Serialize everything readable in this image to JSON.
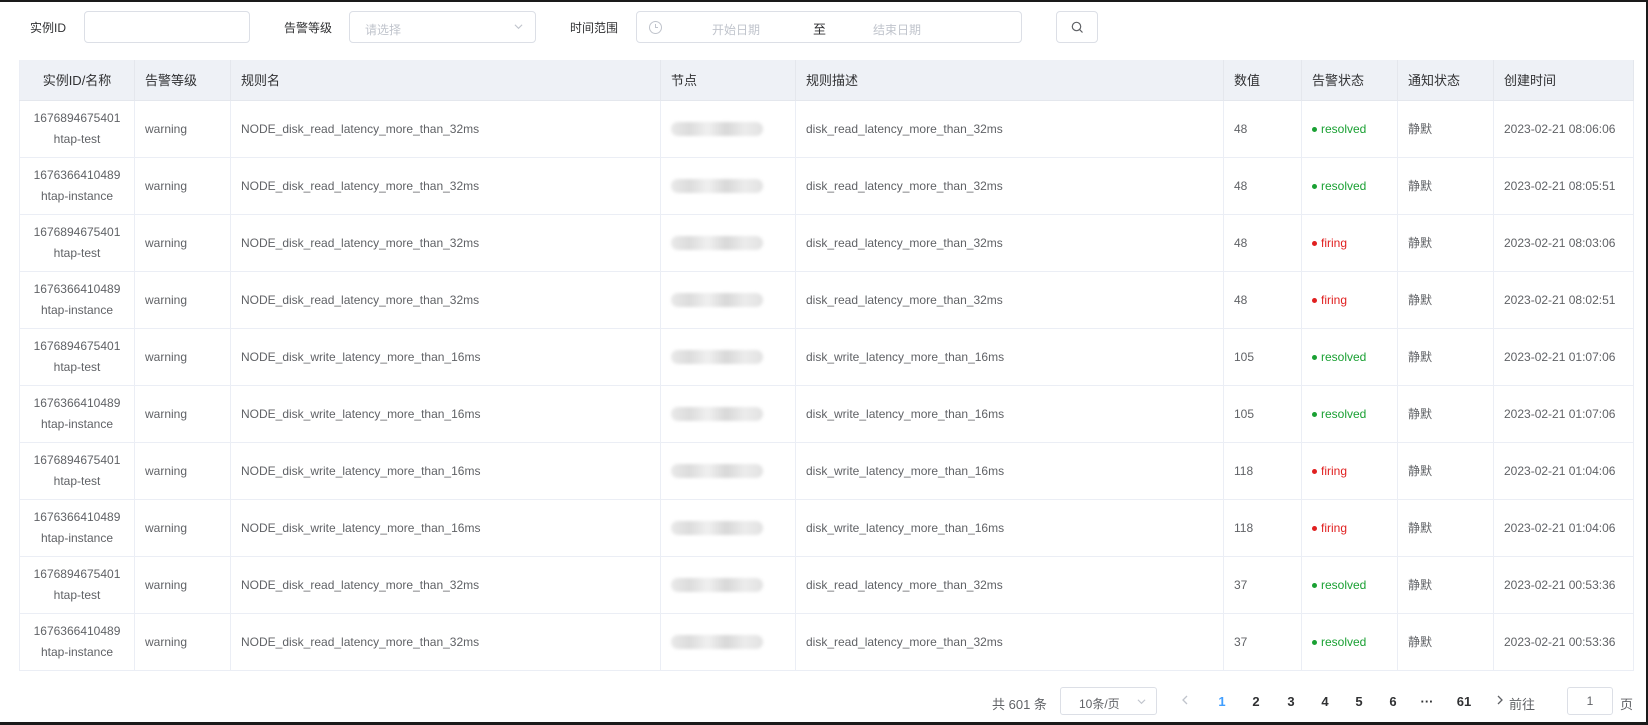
{
  "filters": {
    "instance_id_label": "实例ID",
    "instance_id_value": "",
    "alert_level_label": "告警等级",
    "alert_level_placeholder": "请选择",
    "time_range_label": "时间范围",
    "start_date_placeholder": "开始日期",
    "separator": "至",
    "end_date_placeholder": "结束日期"
  },
  "table": {
    "columns": [
      "实例ID/名称",
      "告警等级",
      "规则名",
      "节点",
      "规则描述",
      "数值",
      "告警状态",
      "通知状态",
      "创建时间"
    ],
    "rows": [
      {
        "id": "1676894675401",
        "name": "htap-test",
        "level": "warning",
        "rule": "NODE_disk_read_latency_more_than_32ms",
        "desc": "disk_read_latency_more_than_32ms",
        "value": "48",
        "status": "resolved",
        "notify": "静默",
        "created": "2023-02-21 08:06:06"
      },
      {
        "id": "1676366410489",
        "name": "htap-instance",
        "level": "warning",
        "rule": "NODE_disk_read_latency_more_than_32ms",
        "desc": "disk_read_latency_more_than_32ms",
        "value": "48",
        "status": "resolved",
        "notify": "静默",
        "created": "2023-02-21 08:05:51"
      },
      {
        "id": "1676894675401",
        "name": "htap-test",
        "level": "warning",
        "rule": "NODE_disk_read_latency_more_than_32ms",
        "desc": "disk_read_latency_more_than_32ms",
        "value": "48",
        "status": "firing",
        "notify": "静默",
        "created": "2023-02-21 08:03:06"
      },
      {
        "id": "1676366410489",
        "name": "htap-instance",
        "level": "warning",
        "rule": "NODE_disk_read_latency_more_than_32ms",
        "desc": "disk_read_latency_more_than_32ms",
        "value": "48",
        "status": "firing",
        "notify": "静默",
        "created": "2023-02-21 08:02:51"
      },
      {
        "id": "1676894675401",
        "name": "htap-test",
        "level": "warning",
        "rule": "NODE_disk_write_latency_more_than_16ms",
        "desc": "disk_write_latency_more_than_16ms",
        "value": "105",
        "status": "resolved",
        "notify": "静默",
        "created": "2023-02-21 01:07:06"
      },
      {
        "id": "1676366410489",
        "name": "htap-instance",
        "level": "warning",
        "rule": "NODE_disk_write_latency_more_than_16ms",
        "desc": "disk_write_latency_more_than_16ms",
        "value": "105",
        "status": "resolved",
        "notify": "静默",
        "created": "2023-02-21 01:07:06"
      },
      {
        "id": "1676894675401",
        "name": "htap-test",
        "level": "warning",
        "rule": "NODE_disk_write_latency_more_than_16ms",
        "desc": "disk_write_latency_more_than_16ms",
        "value": "118",
        "status": "firing",
        "notify": "静默",
        "created": "2023-02-21 01:04:06"
      },
      {
        "id": "1676366410489",
        "name": "htap-instance",
        "level": "warning",
        "rule": "NODE_disk_write_latency_more_than_16ms",
        "desc": "disk_write_latency_more_than_16ms",
        "value": "118",
        "status": "firing",
        "notify": "静默",
        "created": "2023-02-21 01:04:06"
      },
      {
        "id": "1676894675401",
        "name": "htap-test",
        "level": "warning",
        "rule": "NODE_disk_read_latency_more_than_32ms",
        "desc": "disk_read_latency_more_than_32ms",
        "value": "37",
        "status": "resolved",
        "notify": "静默",
        "created": "2023-02-21 00:53:36"
      },
      {
        "id": "1676366410489",
        "name": "htap-instance",
        "level": "warning",
        "rule": "NODE_disk_read_latency_more_than_32ms",
        "desc": "disk_read_latency_more_than_32ms",
        "value": "37",
        "status": "resolved",
        "notify": "静默",
        "created": "2023-02-21 00:53:36"
      }
    ]
  },
  "pagination": {
    "total": "共 601 条",
    "page_size": "10条/页",
    "pages": [
      "1",
      "2",
      "3",
      "4",
      "5",
      "6"
    ],
    "ellipsis": "···",
    "last_page": "61",
    "current_page": "1",
    "goto_label": "前往",
    "goto_value": "1",
    "page_suffix": "页"
  },
  "colors": {
    "accent": "#409eff",
    "resolved": "#1aa033",
    "firing": "#e02020",
    "header_bg": "#eef1f6"
  },
  "icons": {
    "search": "search-icon",
    "clock": "clock-icon",
    "dropdown": "chevron-down-icon",
    "prev": "chevron-left-icon",
    "next": "chevron-right-icon"
  }
}
